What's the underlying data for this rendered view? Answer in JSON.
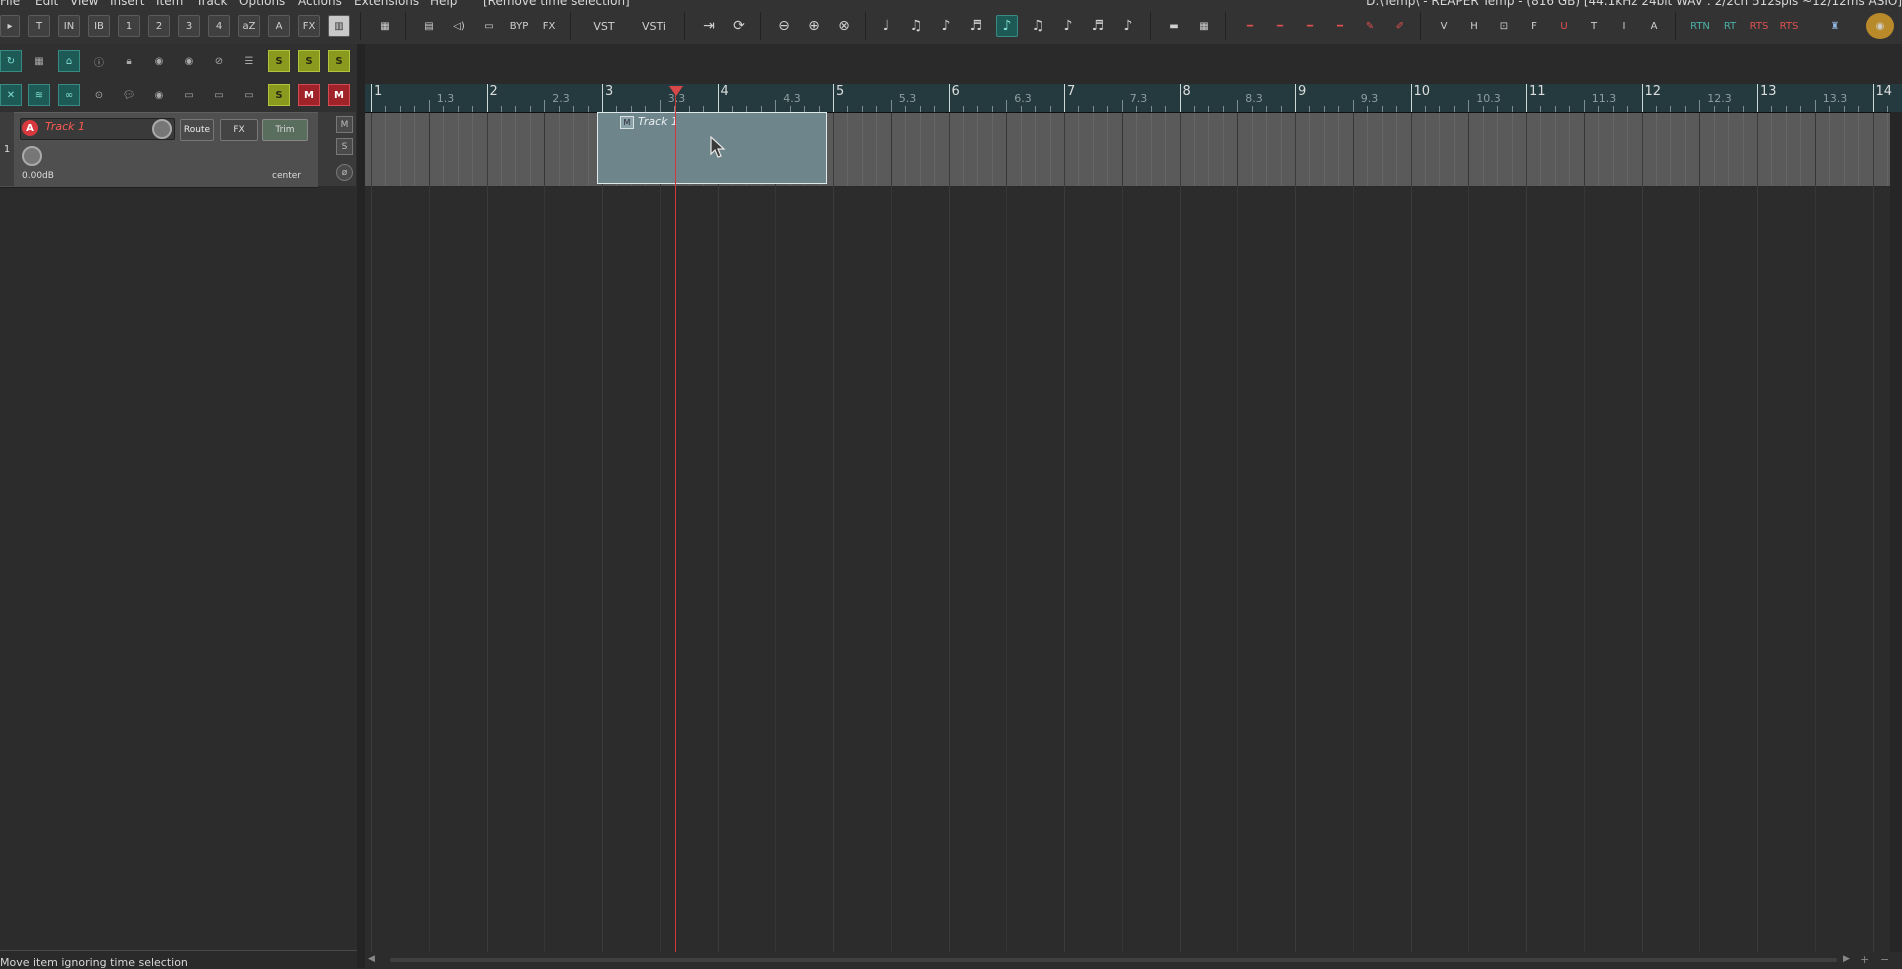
{
  "menu": {
    "items": [
      "File",
      "Edit",
      "View",
      "Insert",
      "Item",
      "Track",
      "Options",
      "Actions",
      "Extensions",
      "Help"
    ],
    "undo_hint": "[Remove time selection]",
    "title_right": "D:\\Temp\\ - REAPER Temp - (816 GB) [44.1kHz 24bit WAV : 2/2ch 512spls ~12/12ms ASIO]"
  },
  "toolbar": {
    "left_labels": [
      "T",
      "IN",
      "IB",
      "1",
      "2",
      "3",
      "4",
      "aZ",
      "A",
      "FX"
    ],
    "byp_label": "BYP",
    "fx_label": "FX",
    "vst_label": "VST",
    "vsti_label": "VSTi",
    "zoom_icons": [
      "V",
      "H",
      "F",
      "U",
      "T",
      "I",
      "A"
    ],
    "right_labels": [
      "RTN",
      "RT",
      "RTS",
      "RTS"
    ]
  },
  "tcp_bar1": {
    "s_labels": [
      "S",
      "S",
      "S"
    ]
  },
  "tcp_bar2": {
    "s_label": "S",
    "m_labels": [
      "M",
      "M"
    ]
  },
  "track": {
    "number": "1",
    "arm_label": "A",
    "name": "Track 1",
    "route_label": "Route",
    "fx_label": "FX",
    "trim_label": "Trim",
    "volume": "0.00dB",
    "pan": "center",
    "mute_label": "M",
    "solo_label": "S"
  },
  "ruler": {
    "bars": [
      "1",
      "2",
      "3",
      "4",
      "5",
      "6",
      "7",
      "8",
      "9",
      "10",
      "11",
      "12",
      "13",
      "14"
    ],
    "subdivisions": [
      "1.3",
      "2.3",
      "3.3",
      "4.3",
      "5.3",
      "6.3",
      "7.3",
      "8.3",
      "9.3",
      "10.3",
      "11.3",
      "12.3",
      "13.3"
    ]
  },
  "item": {
    "title": "Track 1",
    "icon_label": "M"
  },
  "status": {
    "text": "Move item ignoring time selection"
  },
  "colors": {
    "track_name": "#ff5b52",
    "cursor": "#d23a3a",
    "item_fill": "#6f858c",
    "ruler": "#243a3e"
  }
}
